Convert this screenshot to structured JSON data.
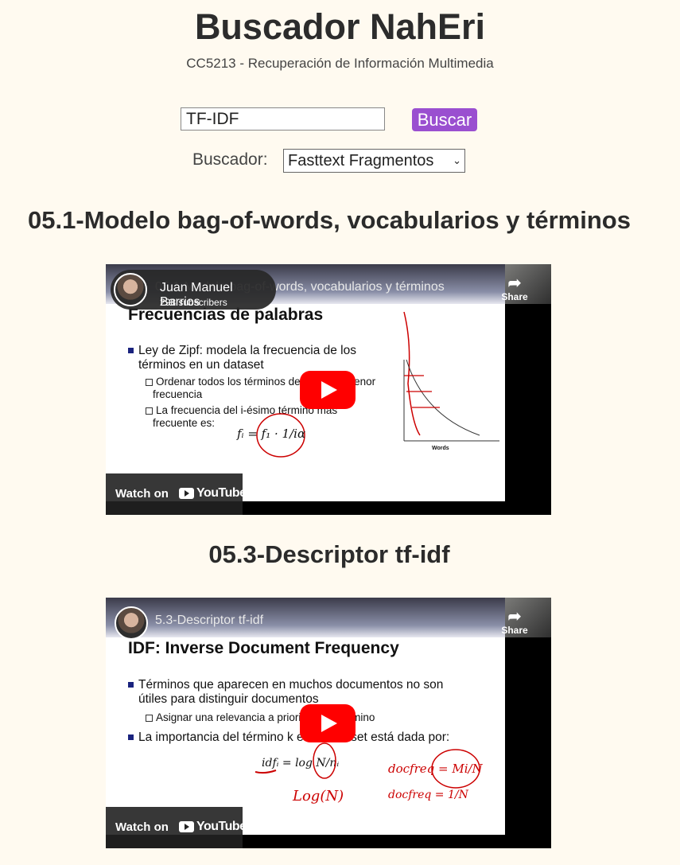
{
  "header": {
    "title": "Buscador NahEri",
    "subtitle": "CC5213 - Recuperación de Información Multimedia"
  },
  "search": {
    "value": "TF-IDF",
    "button_label": "Buscar",
    "engine_label": "Buscador:",
    "engine_selected": "Fasttext Fragmentos"
  },
  "results": [
    {
      "title": "05.1-Modelo bag-of-words, vocabularios y términos",
      "video": {
        "channel": "Juan Manuel Barrios",
        "subscribers": "298 subscribers",
        "video_title": "05.1-Modelo bag-of-words, vocabularios y términos",
        "share": "Share",
        "watch_on": "Watch on",
        "youtube": "YouTube",
        "slide_heading": "Frecuencias de palabras",
        "bullet1": "Ley de Zipf: modela la frecuencia de los",
        "bullet1b": "términos en un dataset",
        "sub1": "Ordenar todos los términos de mayor a menor",
        "sub1b": "frecuencia",
        "sub2": "La frecuencia del i-ésimo término más",
        "sub2b": "frecuente es:",
        "axis_label": "Words"
      }
    },
    {
      "title": "05.3-Descriptor tf-idf",
      "video": {
        "video_title": "5.3-Descriptor tf-idf",
        "share": "Share",
        "watch_on": "Watch on",
        "youtube": "YouTube",
        "slide_heading": "IDF: Inverse Document Frequency",
        "bullet1": "Términos que aparecen en muchos documentos no son",
        "bullet1b": "útiles para distinguir documentos",
        "sub1": "Asignar una relevancia a priori a cada término",
        "bullet2": "La importancia del término k en el dataset está dada por:"
      }
    }
  ],
  "colors": {
    "background": "#fffaf0",
    "button": "#9a4fd0",
    "play": "#ff0000"
  }
}
